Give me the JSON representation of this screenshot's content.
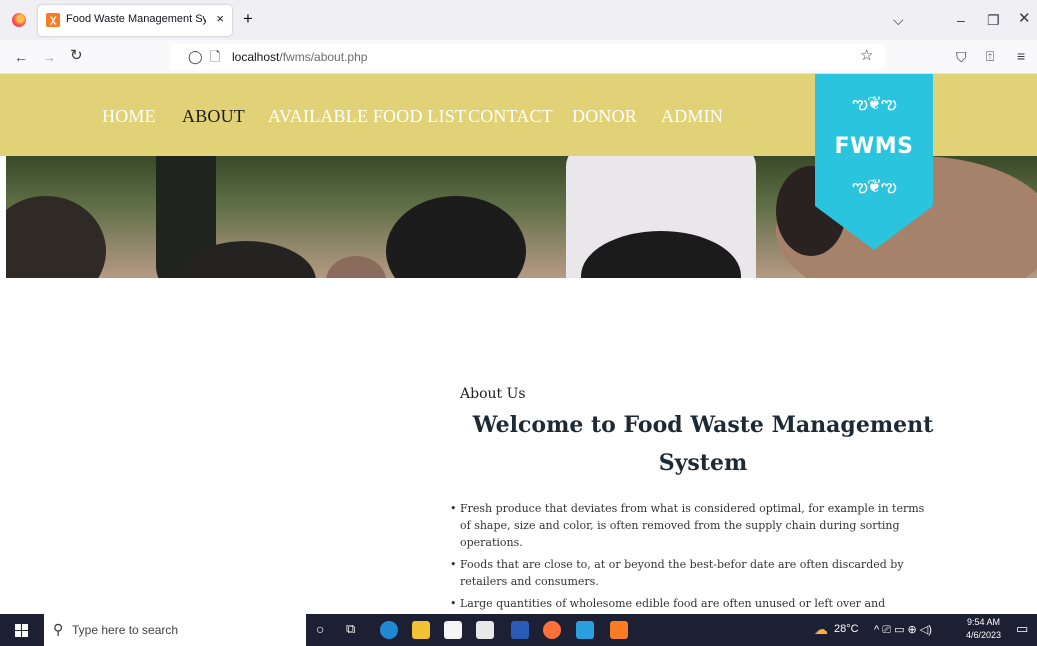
{
  "browser": {
    "tab_title": "Food Waste Management Syste",
    "tab_close": "×",
    "new_tab": "+",
    "url_host": "localhost",
    "url_path": "/fwms/about.php"
  },
  "nav": {
    "items": [
      {
        "label": "HOME"
      },
      {
        "label": "ABOUT"
      },
      {
        "label": "AVAILABLE FOOD LIST"
      },
      {
        "label": "CONTACT"
      },
      {
        "label": "DONOR"
      },
      {
        "label": "ADMIN"
      }
    ],
    "active": "ABOUT"
  },
  "logo": {
    "text": "FWMS"
  },
  "content": {
    "section_label": "About Us",
    "heading": "Welcome to Food Waste Management System",
    "bullets": [
      "Fresh produce that deviates from what is considered optimal, for example in terms of shape, size and color, is often removed from the supply chain during sorting operations.",
      "Foods that are close to, at or beyond the best-befor date are often discarded by retailers and consumers.",
      "Large quantities of wholesome edible food are often unused or left over and discarded from household kitchens and eating establishments."
    ]
  },
  "taskbar": {
    "search_placeholder": "Type here to search",
    "temperature": "28°C",
    "time": "9:54 AM",
    "date": "4/6/2023"
  },
  "colors": {
    "header_bg": "#e2d277",
    "logo_bg": "#2ac4de",
    "taskbar_bg": "#1d1f33"
  }
}
